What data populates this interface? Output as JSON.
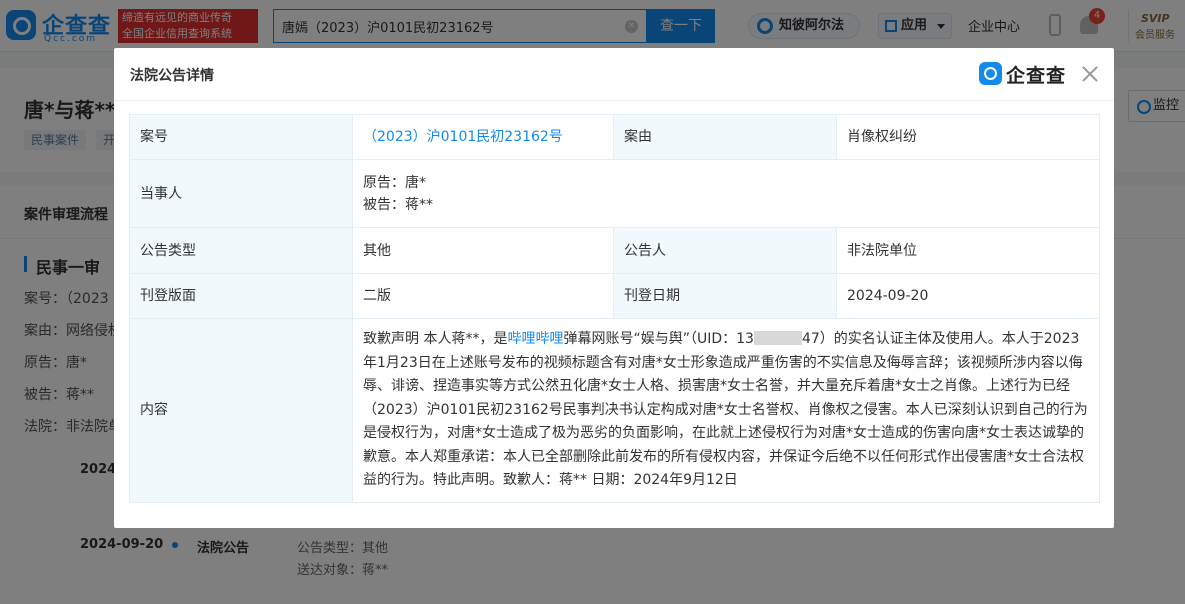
{
  "header": {
    "logo_text": "企查查",
    "logo_sub": "Qcc.com",
    "slogan_line1": "缔造有远见的商业传奇",
    "slogan_line2": "全国企业信用查询系统",
    "search_value": "唐嫣（2023）沪0101民初23162号",
    "search_button": "查一下",
    "nav_zhibi": "知彼阿尔法",
    "nav_app": "应用",
    "nav_center": "企业中心",
    "notification_count": "4",
    "svip_title": "SVIP",
    "svip_sub": "会员服务"
  },
  "page": {
    "title": "唐*与蒋**",
    "tags": [
      "民事案件",
      "开"
    ],
    "monitor_label": "监控",
    "section_title": "案件审理流程",
    "stage_title": "民事一审",
    "fields": [
      {
        "label": "案号：",
        "value": "（2023"
      },
      {
        "label": "案由：",
        "value": "网络侵权"
      },
      {
        "label": "原告：",
        "value": "唐*"
      },
      {
        "label": "被告：",
        "value": "蒋**"
      },
      {
        "label": "法院：",
        "value": "非法院单"
      }
    ],
    "timeline": [
      {
        "date": "2024",
        "event": "",
        "meta1": "",
        "meta2": ""
      },
      {
        "date": "2024-09-20",
        "event": "法院公告",
        "meta1": "公告类型：其他",
        "meta2": "送达对象：蒋**"
      }
    ]
  },
  "modal": {
    "title": "法院公告详情",
    "logo_text": "企查查",
    "labels": {
      "case_no": "案号",
      "cause": "案由",
      "parties": "当事人",
      "notice_type": "公告类型",
      "announcer": "公告人",
      "publish_section": "刊登版面",
      "publish_date": "刊登日期",
      "content": "内容"
    },
    "values": {
      "case_no": "（2023）沪0101民初23162号",
      "cause": "肖像权纠纷",
      "plaintiff": "原告：唐*",
      "defendant": "被告：蒋**",
      "notice_type": "其他",
      "announcer": "非法院单位",
      "publish_section": "二版",
      "publish_date": "2024-09-20"
    },
    "content": {
      "part1": "致歉声明 本人蒋**，是",
      "platform": "哔哩哔哩",
      "part2": "弹幕网账号“娱与舆”（UID：13",
      "uid_tail": "47）的实名认证主体及使用人。本人于2023年1月23日在上述账号发布的视频标题含有对唐*女士形象造成严重伤害的不实信息及侮辱言辞；该视频所涉内容以侮辱、诽谤、捏造事实等方式公然丑化唐*女士人格、损害唐*女士名誉，并大量充斥着唐*女士之肖像。上述行为已经（2023）沪0101民初23162号民事判决书认定构成对唐*女士名誉权、肖像权之侵害。本人已深刻认识到自己的行为是侵权行为，对唐*女士造成了极为恶劣的负面影响，在此就上述侵权行为对唐*女士造成的伤害向唐*女士表达诚挚的歉意。本人郑重承诺：本人已全部删除此前发布的所有侵权内容，并保证今后绝不以任何形式作出侵害唐*女士合法权益的行为。特此声明。致歉人：蒋** 日期：2024年9月12日"
    }
  }
}
